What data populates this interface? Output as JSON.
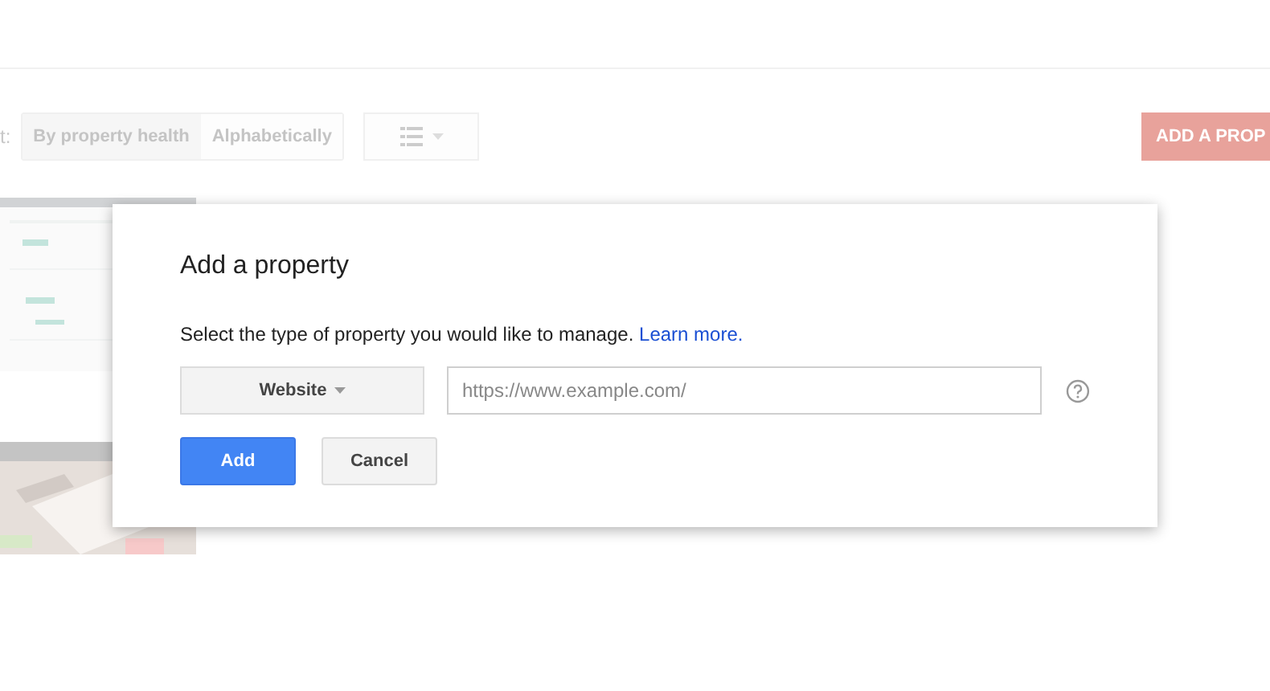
{
  "toolbar": {
    "sort_label": "t:",
    "sort_options": [
      "By property health",
      "Alphabetically"
    ],
    "add_button": "ADD A PROP"
  },
  "dialog": {
    "title": "Add a property",
    "prompt": "Select the type of property you would like to manage.",
    "link": "Learn more.",
    "type_select": "Website",
    "url_field": {
      "placeholder": "https://www.example.com/"
    },
    "buttons": [
      {
        "label": "Add",
        "kind": "primary"
      },
      {
        "label": "Cancel",
        "kind": "secondary"
      }
    ]
  }
}
